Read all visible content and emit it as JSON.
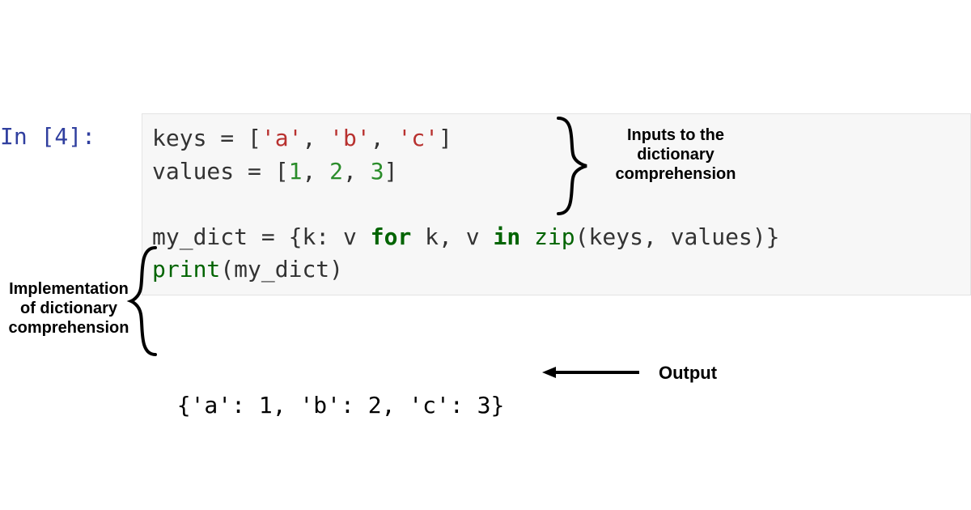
{
  "prompt": {
    "label": "In [4]:"
  },
  "code": {
    "line1": {
      "var": "keys",
      "eq": " = ",
      "lb": "[",
      "a": "'a'",
      "c1": ", ",
      "b": "'b'",
      "c2": ", ",
      "c": "'c'",
      "rb": "]"
    },
    "line2": {
      "var": "values",
      "eq": " = ",
      "lb": "[",
      "n1": "1",
      "c1": ", ",
      "n2": "2",
      "c2": ", ",
      "n3": "3",
      "rb": "]"
    },
    "line3": "",
    "line4": {
      "var": "my_dict",
      "eq": " = ",
      "lb": "{",
      "kv": "k: v ",
      "for": "for",
      "mid": " k, v ",
      "in": "in",
      "sp": " ",
      "zip": "zip",
      "args": "(keys, values)}"
    },
    "line5": {
      "print": "print",
      "args": "(my_dict)"
    }
  },
  "output": {
    "text": "{'a': 1, 'b': 2, 'c': 3}"
  },
  "annotations": {
    "inputs": "Inputs to the\ndictionary\ncomprehension",
    "impl": "Implementation\nof dictionary\ncomprehension",
    "output": "Output"
  }
}
